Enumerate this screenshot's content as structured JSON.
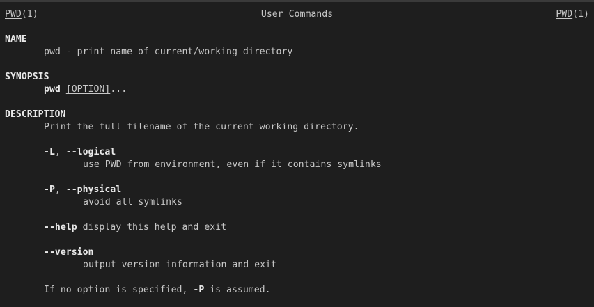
{
  "header": {
    "left_name": "PWD",
    "left_section": "(1)",
    "center_title": "User Commands",
    "right_name": "PWD",
    "right_section": "(1)"
  },
  "sections": {
    "name": {
      "heading": "NAME",
      "text": "pwd - print name of current/working directory"
    },
    "synopsis": {
      "heading": "SYNOPSIS",
      "command": "pwd",
      "space": " ",
      "option": "[OPTION]",
      "ellipsis": "..."
    },
    "description": {
      "heading": "DESCRIPTION",
      "text": "Print the full filename of the current working directory.",
      "logical_short": "-L",
      "logical_sep": ", ",
      "logical_long": "--logical",
      "logical_desc": "use PWD from environment, even if it contains symlinks",
      "physical_short": "-P",
      "physical_sep": ", ",
      "physical_long": "--physical",
      "physical_desc": "avoid all symlinks",
      "help_flag": "--help",
      "help_desc": " display this help and exit",
      "version_flag": "--version",
      "version_desc": "output version information and exit",
      "default_pre": "If no option is specified, ",
      "default_flag": "-P",
      "default_post": " is assumed."
    }
  }
}
